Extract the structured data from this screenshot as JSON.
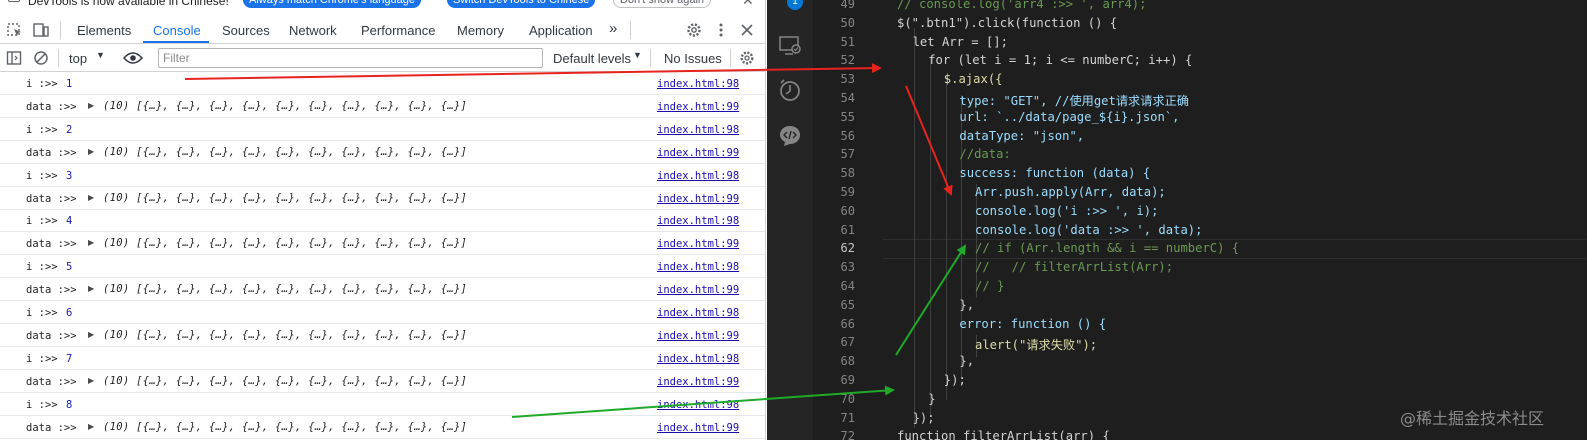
{
  "infobar": {
    "message": "DevTools is now available in Chinese!",
    "btn_always": "Always match Chrome's language",
    "btn_switch": "Switch DevTools to Chinese",
    "btn_dont": "Don't show again"
  },
  "tabs": [
    "Elements",
    "Console",
    "Sources",
    "Network",
    "Performance",
    "Memory",
    "Application"
  ],
  "active_tab": "Console",
  "more_tabs": "»",
  "toolbar": {
    "context": "top",
    "filter_placeholder": "Filter",
    "levels": "Default levels",
    "issues": "No Issues"
  },
  "log_rows": [
    {
      "label": "i :>>",
      "value": "1",
      "source": "index.html:98"
    },
    {
      "label": "data :>>",
      "value": "(10) [{…}, {…}, {…}, {…}, {…}, {…}, {…}, {…}, {…}, {…}]",
      "source": "index.html:99"
    },
    {
      "label": "i :>>",
      "value": "2",
      "source": "index.html:98"
    },
    {
      "label": "data :>>",
      "value": "(10) [{…}, {…}, {…}, {…}, {…}, {…}, {…}, {…}, {…}, {…}]",
      "source": "index.html:99"
    },
    {
      "label": "i :>>",
      "value": "3",
      "source": "index.html:98"
    },
    {
      "label": "data :>>",
      "value": "(10) [{…}, {…}, {…}, {…}, {…}, {…}, {…}, {…}, {…}, {…}]",
      "source": "index.html:99"
    },
    {
      "label": "i :>>",
      "value": "4",
      "source": "index.html:98"
    },
    {
      "label": "data :>>",
      "value": "(10) [{…}, {…}, {…}, {…}, {…}, {…}, {…}, {…}, {…}, {…}]",
      "source": "index.html:99"
    },
    {
      "label": "i :>>",
      "value": "5",
      "source": "index.html:98"
    },
    {
      "label": "data :>>",
      "value": "(10) [{…}, {…}, {…}, {…}, {…}, {…}, {…}, {…}, {…}, {…}]",
      "source": "index.html:99"
    },
    {
      "label": "i :>>",
      "value": "6",
      "source": "index.html:98"
    },
    {
      "label": "data :>>",
      "value": "(10) [{…}, {…}, {…}, {…}, {…}, {…}, {…}, {…}, {…}, {…}]",
      "source": "index.html:99"
    },
    {
      "label": "i :>>",
      "value": "7",
      "source": "index.html:98"
    },
    {
      "label": "data :>>",
      "value": "(10) [{…}, {…}, {…}, {…}, {…}, {…}, {…}, {…}, {…}, {…}]",
      "source": "index.html:99"
    },
    {
      "label": "i :>>",
      "value": "8",
      "source": "index.html:98"
    },
    {
      "label": "data :>>",
      "value": "(10) [{…}, {…}, {…}, {…}, {…}, {…}, {…}, {…}, {…}, {…}]",
      "source": "index.html:99"
    }
  ],
  "activity": {
    "badge": "1"
  },
  "editor": {
    "current_line": "62",
    "lines": [
      {
        "n": "49",
        "text": "// console.log('arr4 :>> ', arr4);"
      },
      {
        "n": "50",
        "text": "$(\".btn1\").click(function () {"
      },
      {
        "n": "51",
        "text": "let Arr = [];"
      },
      {
        "n": "52",
        "text": "for (let i = 1; i <= numberC; i++) {"
      },
      {
        "n": "53",
        "text": "$.ajax({"
      },
      {
        "n": "54",
        "text": "type: \"GET\", //使用get请求请求正确"
      },
      {
        "n": "55",
        "text": "url: `../data/page_${i}.json`,"
      },
      {
        "n": "56",
        "text": "dataType: \"json\","
      },
      {
        "n": "57",
        "text": "//data:"
      },
      {
        "n": "58",
        "text": "success: function (data) {"
      },
      {
        "n": "59",
        "text": "Arr.push.apply(Arr, data);"
      },
      {
        "n": "60",
        "text": "console.log('i :>> ', i);"
      },
      {
        "n": "61",
        "text": "console.log('data :>> ', data);"
      },
      {
        "n": "62",
        "text": "// if (Arr.length && i == numberC) {"
      },
      {
        "n": "63",
        "text": "//   // filterArrList(Arr);"
      },
      {
        "n": "64",
        "text": "// }"
      },
      {
        "n": "65",
        "text": "},"
      },
      {
        "n": "66",
        "text": "error: function () {"
      },
      {
        "n": "67",
        "text": "alert(\"请求失败\");"
      },
      {
        "n": "68",
        "text": "},"
      },
      {
        "n": "69",
        "text": "});"
      },
      {
        "n": "70",
        "text": "}"
      },
      {
        "n": "71",
        "text": "});"
      },
      {
        "n": "72",
        "text": "function filterArrList(arr) {"
      }
    ]
  },
  "watermark": "@稀土掘金技术社区",
  "colors": {
    "accent": "#1a73e8",
    "editor_bg": "#1e1e1e",
    "activity_bg": "#252526",
    "arrow_red": "#e8231e",
    "arrow_green": "#1faa2a"
  }
}
